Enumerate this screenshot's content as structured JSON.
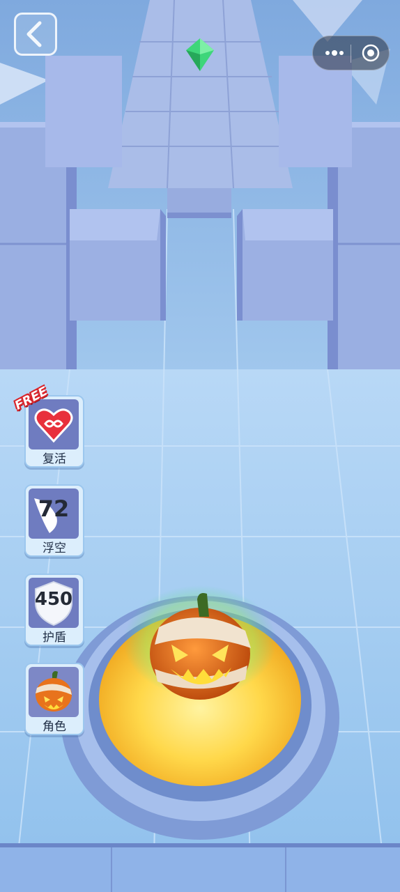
{
  "hud": {
    "back_icon": "back-arrow-icon",
    "menu": {
      "more_icon": "more-dots-icon",
      "close_icon": "target-close-icon"
    }
  },
  "powerups": [
    {
      "id": "revive",
      "label": "复活",
      "badge": "FREE",
      "icon": "infinity-heart-icon"
    },
    {
      "id": "float",
      "label": "浮空",
      "count": "72",
      "icon": "feather-icon"
    },
    {
      "id": "shield",
      "label": "护盾",
      "count": "450",
      "icon": "shield-icon"
    },
    {
      "id": "character",
      "label": "角色",
      "icon": "pumpkin-icon"
    }
  ],
  "colors": {
    "sky": "#8fbde6",
    "block_top": "#9fb4e6",
    "block_side": "#7a8fd0",
    "gem": "#3ed67a",
    "platform_glow": "#ffd84a",
    "pumpkin": "#e8731c"
  }
}
